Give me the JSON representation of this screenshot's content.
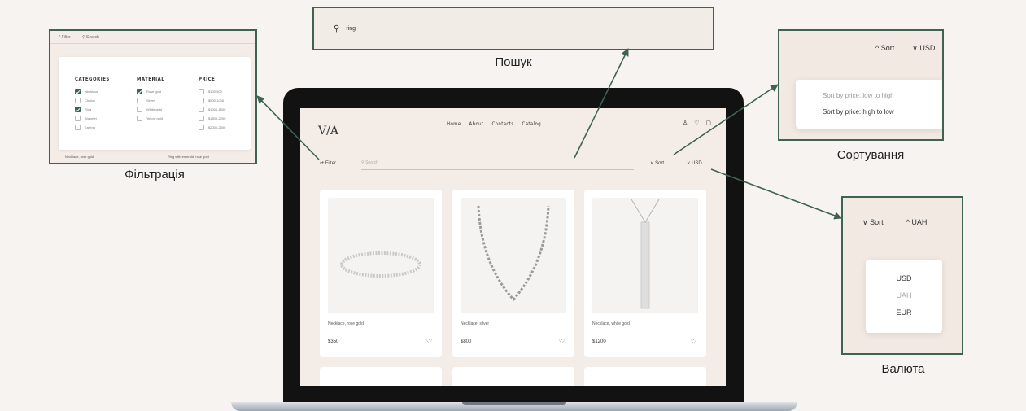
{
  "labels": {
    "filter": "Фільтрація",
    "search": "Пошук",
    "sort": "Сортування",
    "currency": "Валюта"
  },
  "filter_panel": {
    "top_filter": "^ Filter",
    "top_search": "Search",
    "columns": [
      {
        "title": "CATEGORIES",
        "options": [
          {
            "label": "Necklace",
            "checked": true
          },
          {
            "label": "Choker",
            "checked": false
          },
          {
            "label": "Ring",
            "checked": true
          },
          {
            "label": "Bracelet",
            "checked": false
          },
          {
            "label": "Earring",
            "checked": false
          }
        ]
      },
      {
        "title": "MATERIAL",
        "options": [
          {
            "label": "Rose gold",
            "checked": true
          },
          {
            "label": "Silver",
            "checked": false
          },
          {
            "label": "White gold",
            "checked": false
          },
          {
            "label": "Yellow gold",
            "checked": false
          }
        ]
      },
      {
        "title": "PRICE",
        "options": [
          {
            "label": "$100-500",
            "checked": false
          },
          {
            "label": "$500-1000",
            "checked": false
          },
          {
            "label": "$1000-1500",
            "checked": false
          },
          {
            "label": "$1500-2000",
            "checked": false
          },
          {
            "label": "$2000-2500",
            "checked": false
          }
        ]
      }
    ],
    "bottom_left": "Necklace, rose gold",
    "bottom_right": "Ring with emerald, rose gold"
  },
  "search_panel": {
    "query": "ring"
  },
  "sort_panel": {
    "sort": "Sort",
    "currency": "USD",
    "options": [
      "Sort by price: low to high",
      "Sort by price: high to low"
    ]
  },
  "currency_panel": {
    "sort": "Sort",
    "currency": "UAH",
    "options": [
      "USD",
      "UAH",
      "EUR"
    ]
  },
  "site": {
    "logo": "V/A",
    "nav": [
      "Home",
      "About",
      "Contacts",
      "Catalog"
    ],
    "filter": "Filter",
    "search_placeholder": "Search",
    "sort": "Sort",
    "currency": "USD",
    "products": [
      {
        "name": "Necklace, rose gold",
        "price": "$350"
      },
      {
        "name": "Necklace, silver",
        "price": "$800"
      },
      {
        "name": "Necklace, white gold",
        "price": "$1200"
      }
    ]
  },
  "colors": {
    "accent": "#3f6350",
    "background": "#f6f3f0"
  }
}
